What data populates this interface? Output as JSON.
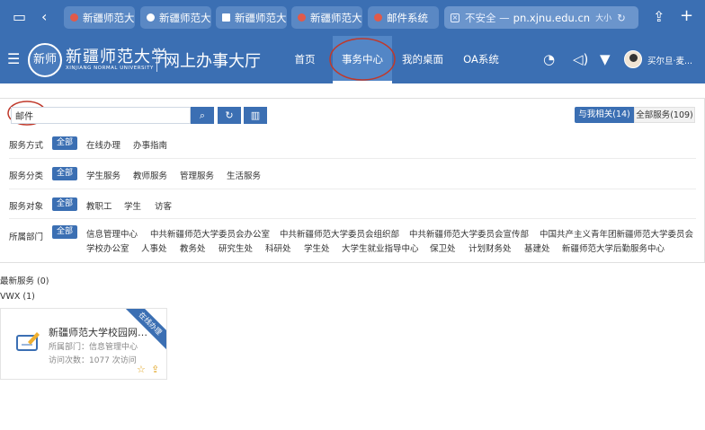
{
  "browser": {
    "tabs": [
      {
        "label": "新疆师范大",
        "fav_color": "#e05a4a"
      },
      {
        "label": "新疆师范大",
        "fav_color": "#ffffff"
      },
      {
        "label": "新疆师范大",
        "fav_color": "#ffffff"
      },
      {
        "label": "新疆师范大",
        "fav_color": "#e05a4a"
      },
      {
        "label": "邮件系统",
        "fav_color": "#e05a4a"
      }
    ],
    "url_tab": {
      "insecure": "不安全 —",
      "url": "pn.xjnu.edu.cn",
      "tail": "大小"
    }
  },
  "header": {
    "logo_seal": "新师",
    "logo_cn": "新疆师范大学",
    "logo_en": "XINJIANG NORMAL UNIVERSITY",
    "site_title": "网上办事大厅",
    "nav": [
      "首页",
      "事务中心",
      "我的桌面",
      "OA系统"
    ],
    "active_nav": "事务中心",
    "username": "买尔旦·麦..."
  },
  "search": {
    "value": "邮件",
    "placeholder": "",
    "related_label": "与我相关(14)",
    "all_label": "全部服务(109)"
  },
  "filters": {
    "all_label": "全部",
    "rows": [
      {
        "label": "服务方式",
        "options": [
          "在线办理",
          "办事指南"
        ]
      },
      {
        "label": "服务分类",
        "options": [
          "学生服务",
          "教师服务",
          "管理服务",
          "生活服务"
        ]
      },
      {
        "label": "服务对象",
        "options": [
          "教职工",
          "学生",
          "访客"
        ]
      },
      {
        "label": "所属部门",
        "options_line1": [
          "信息管理中心",
          "中共新疆师范大学委员会办公室",
          "中共新疆师范大学委员会组织部",
          "中共新疆师范大学委员会宣传部",
          "中国共产主义青年团新疆师范大学委员会"
        ],
        "options_line2": [
          "学校办公室",
          "人事处",
          "教务处",
          "研究生处",
          "科研处",
          "学生处",
          "大学生就业指导中心",
          "保卫处",
          "计划财务处",
          "基建处",
          "新疆师范大学后勤服务中心"
        ]
      }
    ]
  },
  "sections": {
    "latest": "最新服务 (0)",
    "group": "VWX (1)"
  },
  "card": {
    "title": "新疆师范大学校园网用...",
    "ribbon": "在线办理",
    "dept": "所属部门：信息管理中心",
    "visits": "访问次数：1077 次访问"
  },
  "colors": {
    "brand": "#3b6fb3",
    "annotation": "#c0392b"
  }
}
